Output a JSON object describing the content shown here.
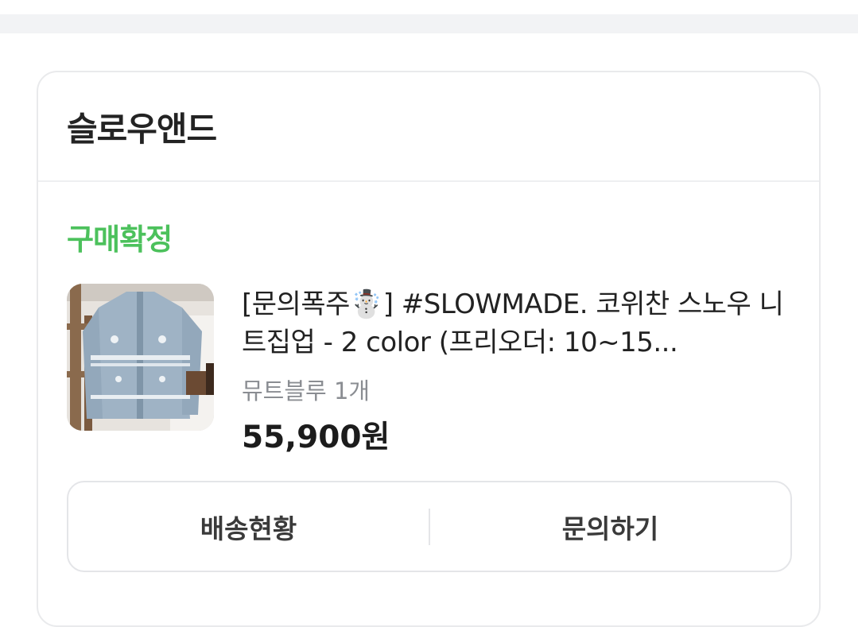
{
  "store": {
    "name": "슬로우앤드"
  },
  "order": {
    "status": "구매확정",
    "status_color": "#4cc15c",
    "product_title": "[문의폭주☃️] #SLOWMADE. 코위찬 스노우 니트집업 - 2 color (프리오더: 10~15...",
    "product_image_icon": "knit-zip-up-sweater-photo",
    "option": "뮤트블루 1개",
    "price": "55,900원"
  },
  "actions": {
    "delivery_label": "배송현황",
    "inquiry_label": "문의하기"
  }
}
